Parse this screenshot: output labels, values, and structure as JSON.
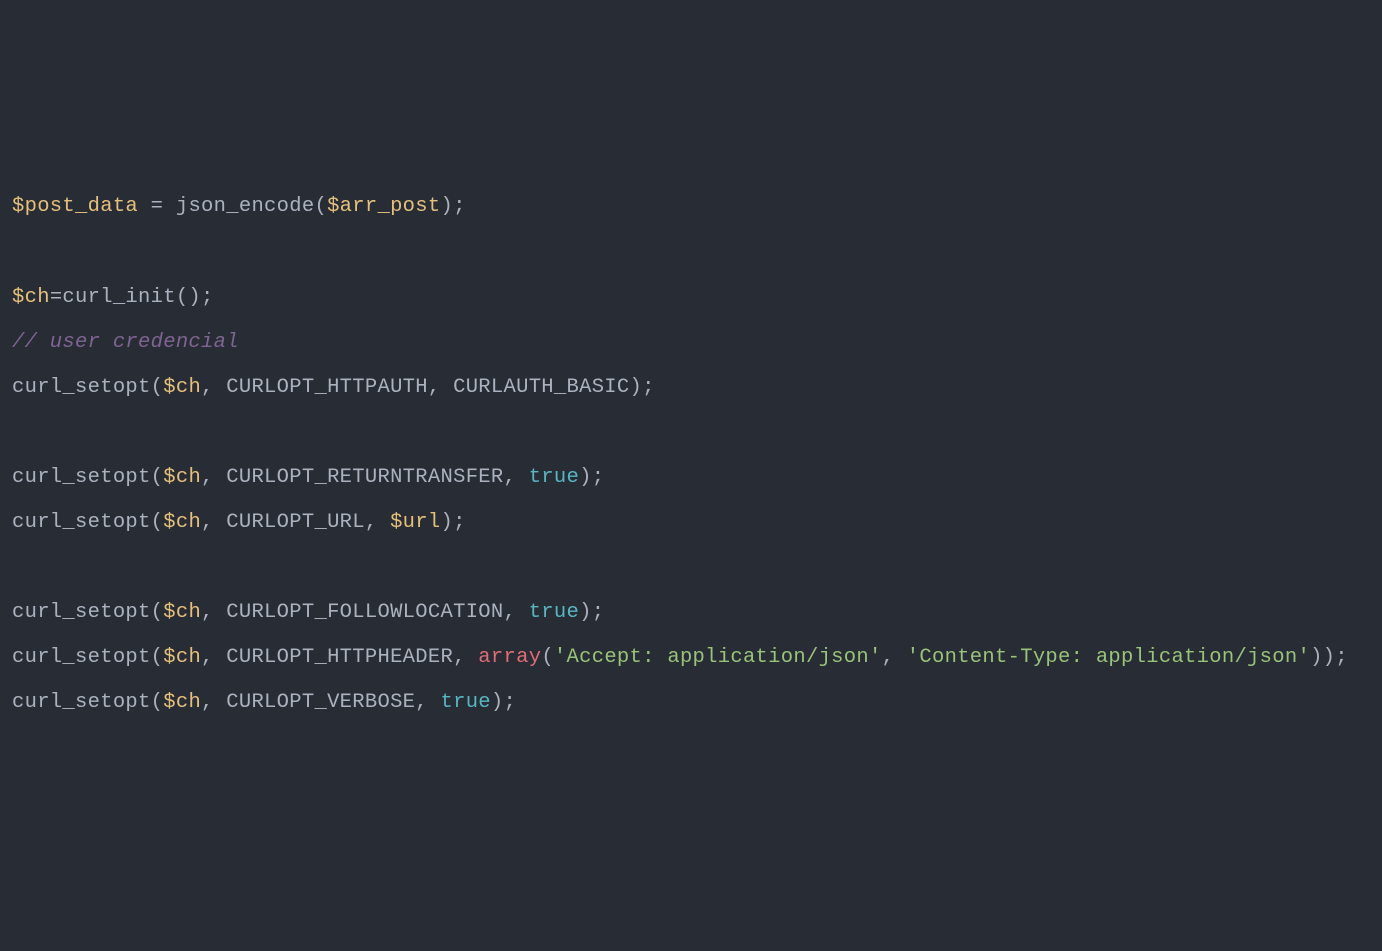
{
  "code": {
    "tokens": [
      {
        "c": "tk-var",
        "t": "$post_data"
      },
      {
        "c": "tk-plain",
        "t": " = json_encode("
      },
      {
        "c": "tk-var",
        "t": "$arr_post"
      },
      {
        "c": "tk-plain",
        "t": ");"
      },
      {
        "br": 2
      },
      {
        "c": "tk-var",
        "t": "$ch"
      },
      {
        "c": "tk-plain",
        "t": "=curl_init();"
      },
      {
        "br": 1
      },
      {
        "c": "tk-comm",
        "t": "// user credencial"
      },
      {
        "br": 1
      },
      {
        "c": "tk-plain",
        "t": "curl_setopt("
      },
      {
        "c": "tk-var",
        "t": "$ch"
      },
      {
        "c": "tk-plain",
        "t": ", CURLOPT_HTTPAUTH, CURLAUTH_BASIC);"
      },
      {
        "br": 2
      },
      {
        "c": "tk-plain",
        "t": "curl_setopt("
      },
      {
        "c": "tk-var",
        "t": "$ch"
      },
      {
        "c": "tk-plain",
        "t": ", CURLOPT_RETURNTRANSFER, "
      },
      {
        "c": "tk-bool",
        "t": "true"
      },
      {
        "c": "tk-plain",
        "t": ");"
      },
      {
        "br": 1
      },
      {
        "c": "tk-plain",
        "t": "curl_setopt("
      },
      {
        "c": "tk-var",
        "t": "$ch"
      },
      {
        "c": "tk-plain",
        "t": ", CURLOPT_URL, "
      },
      {
        "c": "tk-var",
        "t": "$url"
      },
      {
        "c": "tk-plain",
        "t": ");"
      },
      {
        "br": 2
      },
      {
        "c": "tk-plain",
        "t": "curl_setopt("
      },
      {
        "c": "tk-var",
        "t": "$ch"
      },
      {
        "c": "tk-plain",
        "t": ", CURLOPT_FOLLOWLOCATION, "
      },
      {
        "c": "tk-bool",
        "t": "true"
      },
      {
        "c": "tk-plain",
        "t": ");"
      },
      {
        "br": 1
      },
      {
        "c": "tk-plain",
        "t": "curl_setopt("
      },
      {
        "c": "tk-var",
        "t": "$ch"
      },
      {
        "c": "tk-plain",
        "t": ", CURLOPT_HTTPHEADER, "
      },
      {
        "c": "tk-kw",
        "t": "array"
      },
      {
        "c": "tk-plain",
        "t": "("
      },
      {
        "c": "tk-str",
        "t": "'Accept: application/json'"
      },
      {
        "c": "tk-plain",
        "t": ", "
      },
      {
        "c": "tk-str",
        "t": "'Content-Type: application/json'"
      },
      {
        "c": "tk-plain",
        "t": "));"
      },
      {
        "br": 1
      },
      {
        "c": "tk-plain",
        "t": "curl_setopt("
      },
      {
        "c": "tk-var",
        "t": "$ch"
      },
      {
        "c": "tk-plain",
        "t": ", CURLOPT_VERBOSE, "
      },
      {
        "c": "tk-bool",
        "t": "true"
      },
      {
        "c": "tk-plain",
        "t": ");"
      }
    ]
  }
}
